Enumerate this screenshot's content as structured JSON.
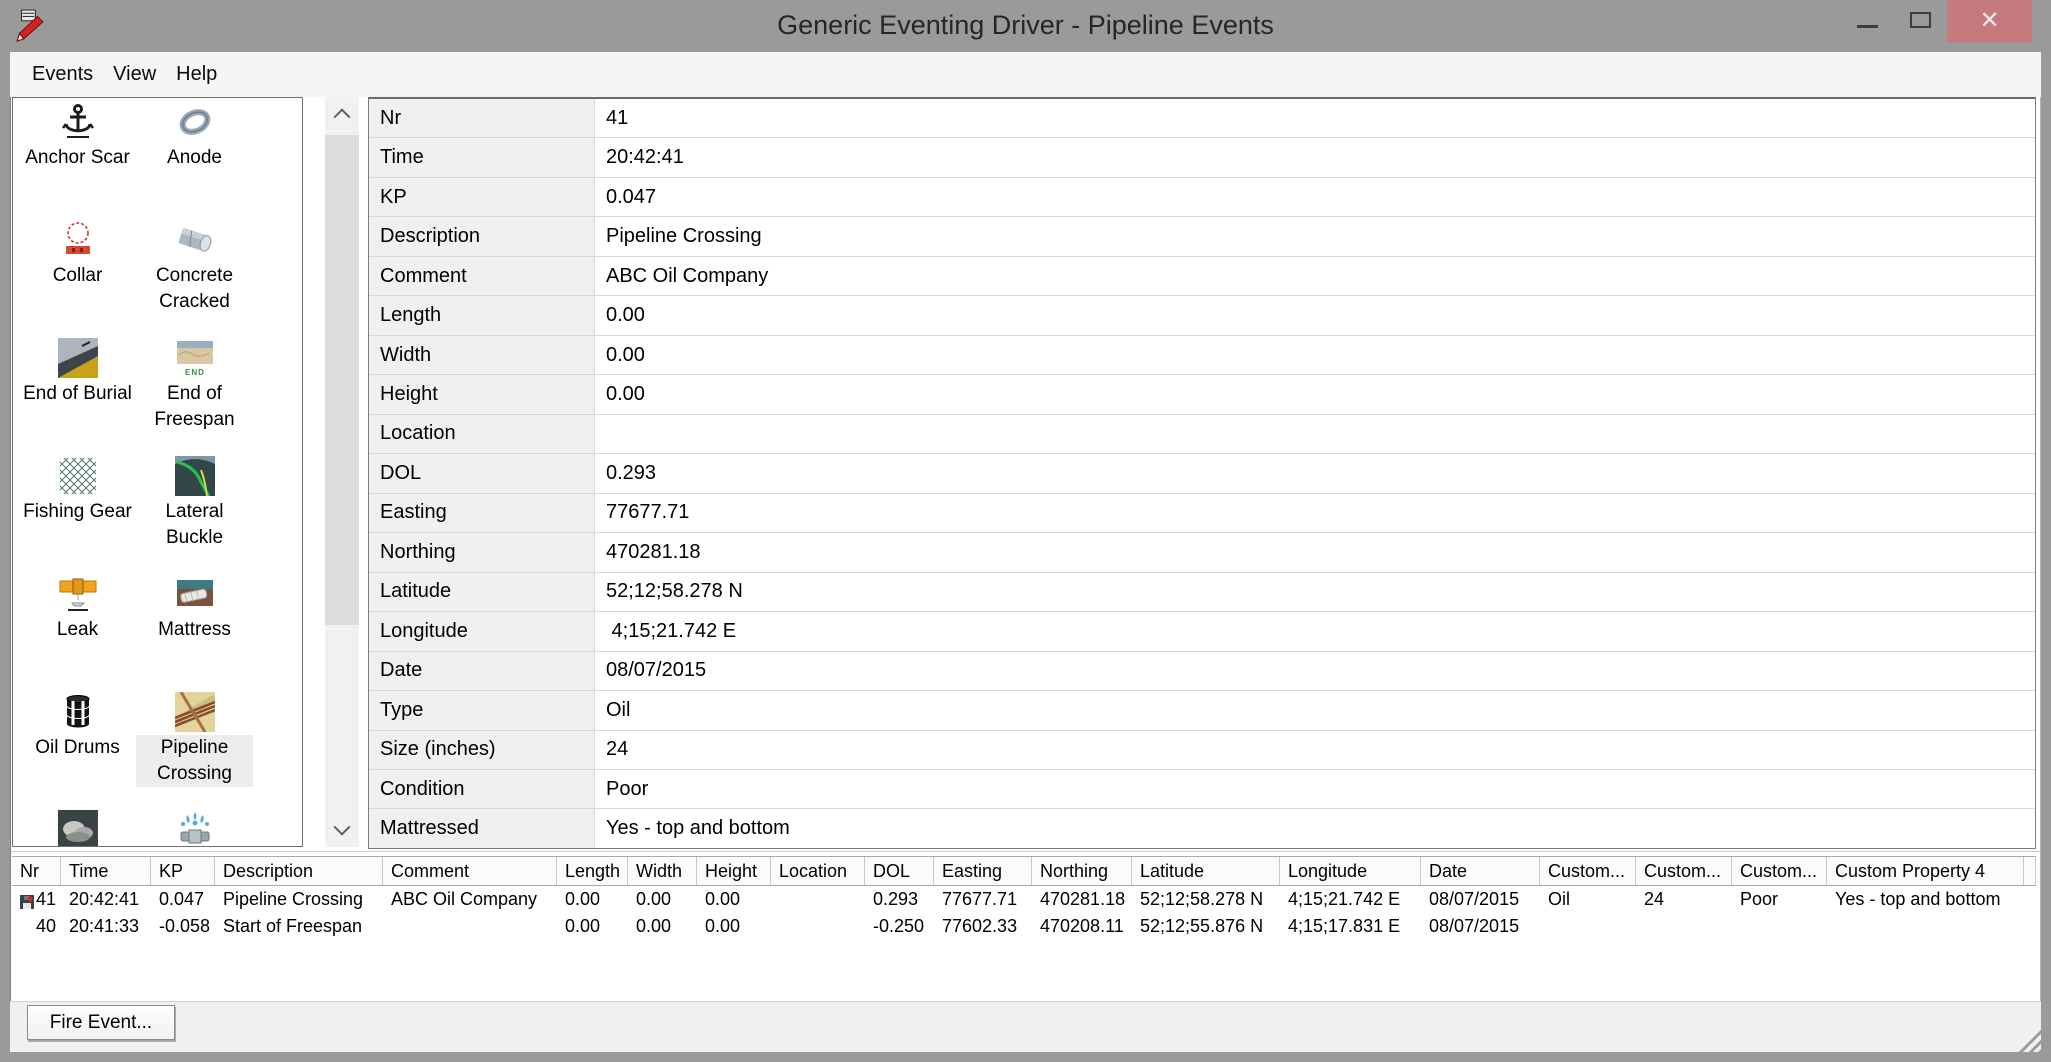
{
  "window": {
    "title": "Generic Eventing Driver - Pipeline Events",
    "close_glyph": "✕"
  },
  "menu": {
    "items": [
      {
        "label": "Events"
      },
      {
        "label": "View"
      },
      {
        "label": "Help"
      }
    ]
  },
  "palette": {
    "items": [
      {
        "label": "Anchor Scar",
        "icon": "anchor-scar-icon",
        "selected": false
      },
      {
        "label": "Anode",
        "icon": "anode-icon",
        "selected": false
      },
      {
        "label": "Collar",
        "icon": "collar-icon",
        "selected": false
      },
      {
        "label": "Concrete Cracked",
        "icon": "concrete-cracked-icon",
        "selected": false
      },
      {
        "label": "End of Burial",
        "icon": "end-of-burial-icon",
        "selected": false
      },
      {
        "label": "End of Freespan",
        "icon": "end-of-freespan-icon",
        "selected": false
      },
      {
        "label": "Fishing Gear",
        "icon": "fishing-gear-icon",
        "selected": false
      },
      {
        "label": "Lateral Buckle",
        "icon": "lateral-buckle-icon",
        "selected": false
      },
      {
        "label": "Leak",
        "icon": "leak-icon",
        "selected": false
      },
      {
        "label": "Mattress",
        "icon": "mattress-icon",
        "selected": false
      },
      {
        "label": "Oil Drums",
        "icon": "oil-drums-icon",
        "selected": false
      },
      {
        "label": "Pipeline Crossing",
        "icon": "pipeline-crossing-icon",
        "selected": true
      },
      {
        "label": "",
        "icon": "rocks-icon",
        "selected": false
      },
      {
        "label": "",
        "icon": "water-spray-icon",
        "selected": false
      }
    ]
  },
  "properties": {
    "rows": [
      {
        "label": "Nr",
        "value": "41"
      },
      {
        "label": "Time",
        "value": "20:42:41"
      },
      {
        "label": "KP",
        "value": "0.047"
      },
      {
        "label": "Description",
        "value": "Pipeline Crossing"
      },
      {
        "label": "Comment",
        "value": "ABC Oil Company"
      },
      {
        "label": "Length",
        "value": "0.00"
      },
      {
        "label": "Width",
        "value": "0.00"
      },
      {
        "label": "Height",
        "value": "0.00"
      },
      {
        "label": "Location",
        "value": ""
      },
      {
        "label": "DOL",
        "value": "0.293"
      },
      {
        "label": "Easting",
        "value": "77677.71"
      },
      {
        "label": "Northing",
        "value": "470281.18"
      },
      {
        "label": "Latitude",
        "value": "52;12;58.278 N"
      },
      {
        "label": "Longitude",
        "value": " 4;15;21.742 E"
      },
      {
        "label": "Date",
        "value": "08/07/2015"
      },
      {
        "label": "Type",
        "value": "Oil"
      },
      {
        "label": "Size (inches)",
        "value": "24"
      },
      {
        "label": "Condition",
        "value": "Poor"
      },
      {
        "label": "Mattressed",
        "value": "Yes - top and bottom"
      }
    ]
  },
  "event_table": {
    "columns": [
      "Nr",
      "Time",
      "KP",
      "Description",
      "Comment",
      "Length",
      "Width",
      "Height",
      "Location",
      "DOL",
      "Easting",
      "Northing",
      "Latitude",
      "Longitude",
      "Date",
      "Custom...",
      "Custom...",
      "Custom...",
      "Custom Property 4"
    ],
    "rows": [
      {
        "cells": [
          "41",
          "20:42:41",
          "0.047",
          "Pipeline Crossing",
          "ABC Oil Company",
          "0.00",
          "0.00",
          "0.00",
          "",
          "0.293",
          "77677.71",
          "470281.18",
          "52;12;58.278 N",
          "4;15;21.742 E",
          "08/07/2015",
          "Oil",
          "24",
          "Poor",
          "Yes - top and bottom"
        ]
      },
      {
        "cells": [
          "40",
          "20:41:33",
          "-0.058",
          "Start of Freespan",
          "",
          "0.00",
          "0.00",
          "0.00",
          "",
          "-0.250",
          "77602.33",
          "470208.11",
          "52;12;55.876 N",
          "4;15;17.831 E",
          "08/07/2015",
          "",
          "",
          "",
          ""
        ]
      }
    ]
  },
  "footer": {
    "fire_event_label": "Fire Event..."
  }
}
